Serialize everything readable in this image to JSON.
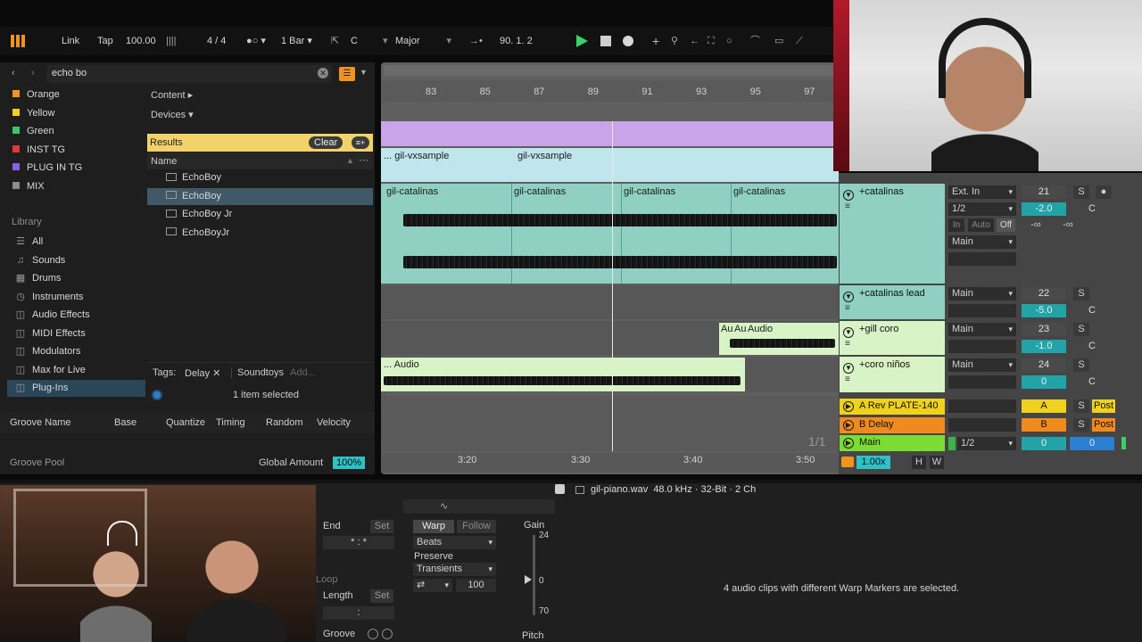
{
  "transport": {
    "link": "Link",
    "tap": "Tap",
    "tempo": "100.00",
    "metronome_glyph": "||||",
    "time_sig": "4 / 4",
    "quantize": "1 Bar",
    "key": "C",
    "scale": "Major",
    "position": "90.  1.  2"
  },
  "browser": {
    "search_value": "echo bo",
    "collections": [
      {
        "label": "Orange",
        "color": "#f0941e"
      },
      {
        "label": "Yellow",
        "color": "#f0d21e"
      },
      {
        "label": "Green",
        "color": "#39c36a"
      },
      {
        "label": "INST TG",
        "color": "#e0383b"
      },
      {
        "label": "PLUG IN TG",
        "color": "#8a5fe8"
      },
      {
        "label": "MIX",
        "color": "#8c8c8c"
      }
    ],
    "library_heading": "Library",
    "library": [
      {
        "label": "All",
        "icon": "☰"
      },
      {
        "label": "Sounds",
        "icon": "♫"
      },
      {
        "label": "Drums",
        "icon": "▦"
      },
      {
        "label": "Instruments",
        "icon": "◷"
      },
      {
        "label": "Audio Effects",
        "icon": "◫"
      },
      {
        "label": "MIDI Effects",
        "icon": "◫"
      },
      {
        "label": "Modulators",
        "icon": "◫"
      },
      {
        "label": "Max for Live",
        "icon": "◫"
      },
      {
        "label": "Plug-Ins",
        "icon": "◫"
      }
    ],
    "filters": {
      "content": "Content ▸",
      "devices": "Devices ▾",
      "partial": "Delay"
    },
    "results_title": "Results",
    "clear": "Clear",
    "name_header": "Name",
    "results": [
      "EchoBoy",
      "EchoBoy",
      "EchoBoy Jr",
      "EchoBoyJr"
    ],
    "tags_label": "Tags:",
    "tags": [
      "Delay",
      "Soundtoys"
    ],
    "add_tag": "Add...",
    "selection_status": "1 item selected"
  },
  "groove": {
    "headers": [
      "Groove Name",
      "Base",
      "Quantize",
      "Timing",
      "Random",
      "Velocity"
    ],
    "pool_label": "Groove Pool",
    "global_amount_label": "Global Amount",
    "global_amount": "100%"
  },
  "arrangement": {
    "ruler": [
      "83",
      "85",
      "87",
      "89",
      "91",
      "93",
      "95",
      "97"
    ],
    "times": [
      "3:20",
      "3:30",
      "3:40",
      "3:50"
    ],
    "clips": {
      "vx1": "... gil-vxsample",
      "vx2": "gil-vxsample",
      "cat": [
        "gil-catalinas",
        "gil-catalinas",
        "gil-catalinas",
        "gil-catalinas"
      ],
      "coro": [
        "Au",
        "Au",
        "Audio"
      ],
      "ninos": "... Audio"
    },
    "page_indicator": "1/1"
  },
  "tracks": [
    {
      "name": "+catalinas",
      "input": "Ext. In",
      "channel": "1/2",
      "monitor": [
        "In",
        "Auto",
        "Off"
      ],
      "output": "Main",
      "number": "21",
      "volume": "-2.0",
      "pan": "C"
    },
    {
      "name": "+catalinas lead",
      "output": "Main",
      "number": "22",
      "volume": "-5.0",
      "pan": "C"
    },
    {
      "name": "+gill coro",
      "output": "Main",
      "number": "23",
      "volume": "-1.0",
      "pan": "C"
    },
    {
      "name": "+coro niños",
      "output": "Main",
      "number": "24",
      "volume": "0",
      "pan": "C"
    }
  ],
  "returns": [
    {
      "name": "A Rev PLATE-140",
      "letter": "A",
      "post": "Post",
      "color": "#f0d21e"
    },
    {
      "name": "B Delay",
      "letter": "B",
      "post": "Post",
      "color": "#f08a1e"
    }
  ],
  "main_track": {
    "name": "Main",
    "channel": "1/2",
    "volume": "0",
    "pan": "0"
  },
  "solo_label": "S",
  "inf": "-∞",
  "zoom": "1.00x",
  "hw": [
    "H",
    "W"
  ],
  "clip_view": {
    "file_info": "gil-piano.wav  48.0 kHz · 32-Bit · 2 Ch",
    "end": "End",
    "set": "Set",
    "loop": "Loop",
    "length": "Length",
    "groove": "Groove",
    "warp": "Warp",
    "follow": "Follow",
    "mode": "Beats",
    "preserve": "Preserve",
    "transients": "Transients",
    "percent": "100",
    "gain": "Gain",
    "gain_top": "24",
    "gain_mid": "0",
    "gain_bot": "70",
    "pitch": "Pitch",
    "message": "4 audio clips with different Warp Markers are selected."
  }
}
